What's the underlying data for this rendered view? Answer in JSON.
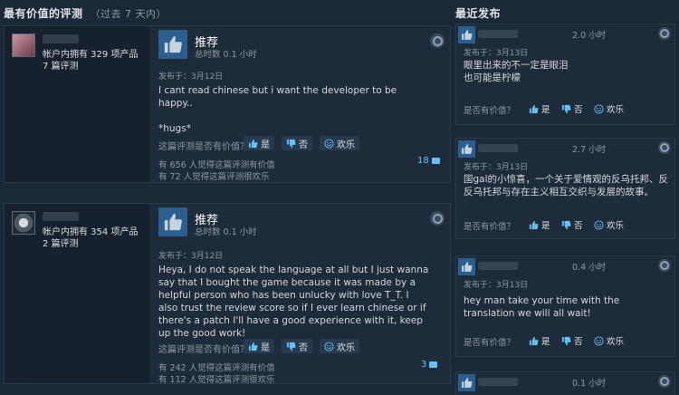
{
  "left_header": {
    "title": "最有价值的评测",
    "range": "（过去 7 天内）"
  },
  "right_header": {
    "title": "最近发布"
  },
  "reviews": [
    {
      "owned": "帐户内拥有 329 项产品",
      "review_count": "7 篇评测",
      "rating": "推荐",
      "hours": "总时数 0.1 小时",
      "date": "发布于：3月12日",
      "text": "I cant read chinese but i want the developer to be happy..\n\n*hugs*",
      "helpful_q": "这篇评测是否有价值？",
      "yes": "是",
      "no": "否",
      "funny": "欢乐",
      "helpful_stat": "有 656 人觉得这篇评测有价值",
      "funny_stat": "有 72 人觉得这篇评测很欢乐",
      "comments": "18"
    },
    {
      "owned": "帐户内拥有 354 项产品",
      "review_count": "2 篇评测",
      "rating": "推荐",
      "hours": "总时数 0.1 小时",
      "date": "发布于：3月12日",
      "text": "Heya, I do not speak the language at all but I just wanna say that I bought the game because it was made by a helpful person who has been unlucky with love T_T. I also trust the review score so if I ever learn chinese or if there's a patch I'll have a good experience with it, keep up the good work!",
      "helpful_q": "这篇评测是否有价值？",
      "yes": "是",
      "no": "否",
      "funny": "欢乐",
      "helpful_stat": "有 242 人觉得这篇评测有价值",
      "funny_stat": "有 112 人觉得这篇评测很欢乐",
      "comments": "3"
    }
  ],
  "recent": [
    {
      "hours": "2.0 小时",
      "date": "发布于：3月13日",
      "text": "眼里出来的不一定是眼泪\n也可能是柠檬",
      "help": "是否有价值？",
      "yes": "是",
      "no": "否",
      "funny": "欢乐"
    },
    {
      "hours": "2.7 小时",
      "date": "发布于：3月13日",
      "text": "国gal的小惊喜，一个关于爱情观的反乌托邦、反反乌托邦与存在主义相互交织与发展的故事。",
      "help": "是否有价值？",
      "yes": "是",
      "no": "否",
      "funny": "欢乐"
    },
    {
      "hours": "0.4 小时",
      "date": "发布于：3月13日",
      "text": "hey man take your time with the translation we will all wait!",
      "help": "是否有价值？",
      "yes": "是",
      "no": "否",
      "funny": "欢乐"
    },
    {
      "hours": "0.1 小时"
    }
  ],
  "icons": {
    "thumb": "thumbs-up-icon",
    "down": "thumbs-down-icon",
    "smile": "smiley-icon",
    "steam": "steam-logo-icon",
    "comment": "comment-icon"
  },
  "colors": {
    "bg": "#1b2838",
    "accent": "#66c0f4",
    "thumb_bg": "#2a5f8f"
  }
}
